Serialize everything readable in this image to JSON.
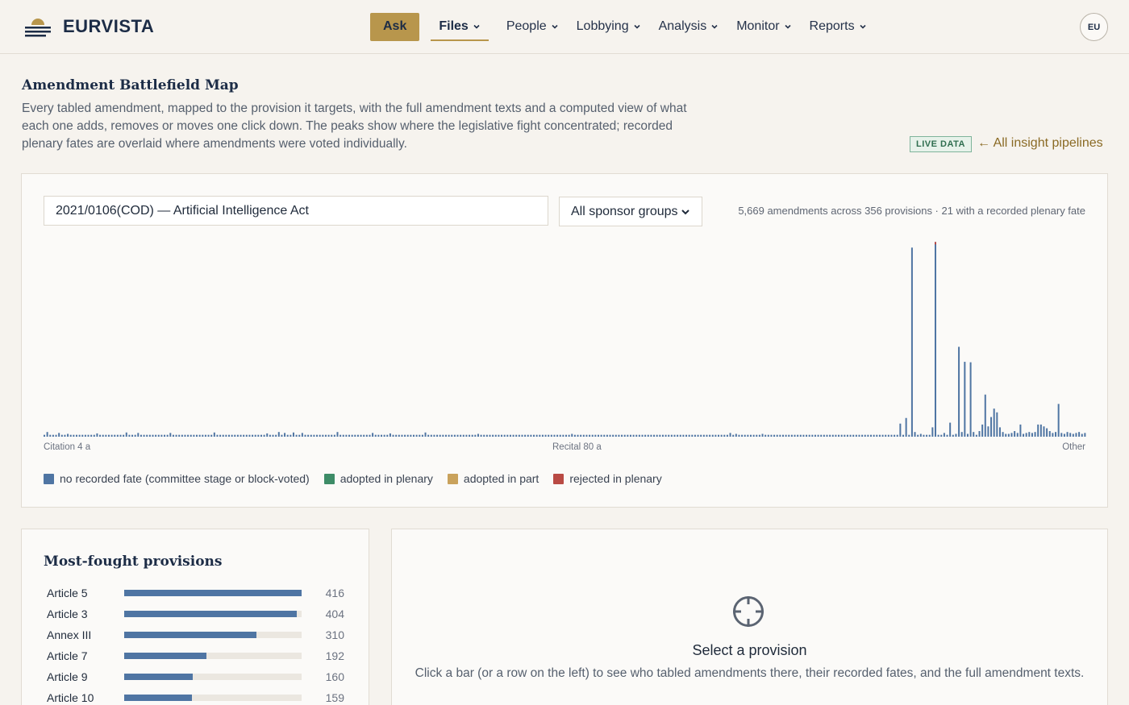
{
  "header": {
    "brand": "EURVISTA",
    "ask_label": "Ask",
    "nav": [
      "Files",
      "People",
      "Lobbying",
      "Analysis",
      "Monitor",
      "Reports"
    ],
    "avatar": "EU"
  },
  "intro": {
    "title": "Amendment Battlefield Map",
    "description": "Every tabled amendment, mapped to the provision it targets, with the full amendment texts and a computed view of what each one adds, removes or moves one click down. The peaks show where the legislative fight concentrated; recorded plenary fates are overlaid where amendments were voted individually.",
    "badge": "LIVE DATA",
    "back_link": "← All insight pipelines"
  },
  "filters": {
    "file_value": "2021/0106(COD) — Artificial Intelligence Act",
    "group_value": "All sponsor groups",
    "summary": "5,669 amendments across 356 provisions · 21 with a recorded plenary fate"
  },
  "chart_data": {
    "type": "bar",
    "title": "",
    "xlabel": "",
    "ylabel": "",
    "x_tick_labels": [
      "Citation 4 a",
      "Recital 80 a",
      "Other"
    ],
    "ylim": [
      0,
      420
    ],
    "grid": false,
    "legend_placement": "bottom-left",
    "categories_count": 356,
    "default_value": 4,
    "peaks": [
      {
        "index": 1,
        "value": 10
      },
      {
        "index": 5,
        "value": 8
      },
      {
        "index": 8,
        "value": 6
      },
      {
        "index": 18,
        "value": 7
      },
      {
        "index": 28,
        "value": 9
      },
      {
        "index": 32,
        "value": 8
      },
      {
        "index": 43,
        "value": 8
      },
      {
        "index": 58,
        "value": 9
      },
      {
        "index": 76,
        "value": 7
      },
      {
        "index": 80,
        "value": 10
      },
      {
        "index": 82,
        "value": 8
      },
      {
        "index": 85,
        "value": 9
      },
      {
        "index": 88,
        "value": 8
      },
      {
        "index": 100,
        "value": 10
      },
      {
        "index": 112,
        "value": 8
      },
      {
        "index": 118,
        "value": 7
      },
      {
        "index": 130,
        "value": 9
      },
      {
        "index": 148,
        "value": 6
      },
      {
        "index": 180,
        "value": 6
      },
      {
        "index": 234,
        "value": 8
      },
      {
        "index": 236,
        "value": 6
      },
      {
        "index": 245,
        "value": 6
      },
      {
        "index": 292,
        "value": 28
      },
      {
        "index": 294,
        "value": 40
      },
      {
        "index": 296,
        "value": 404
      },
      {
        "index": 297,
        "value": 10
      },
      {
        "index": 299,
        "value": 6
      },
      {
        "index": 301,
        "value": 4
      },
      {
        "index": 303,
        "value": 20
      },
      {
        "index": 304,
        "value": 416,
        "fate": "rejected"
      },
      {
        "index": 307,
        "value": 8
      },
      {
        "index": 309,
        "value": 30
      },
      {
        "index": 311,
        "value": 6
      },
      {
        "index": 312,
        "value": 192
      },
      {
        "index": 313,
        "value": 10
      },
      {
        "index": 314,
        "value": 160
      },
      {
        "index": 315,
        "value": 6
      },
      {
        "index": 316,
        "value": 159
      },
      {
        "index": 317,
        "value": 10
      },
      {
        "index": 319,
        "value": 12
      },
      {
        "index": 320,
        "value": 26
      },
      {
        "index": 321,
        "value": 90
      },
      {
        "index": 322,
        "value": 22
      },
      {
        "index": 323,
        "value": 42
      },
      {
        "index": 324,
        "value": 60
      },
      {
        "index": 325,
        "value": 52
      },
      {
        "index": 326,
        "value": 20
      },
      {
        "index": 327,
        "value": 10
      },
      {
        "index": 328,
        "value": 6
      },
      {
        "index": 329,
        "value": 6
      },
      {
        "index": 330,
        "value": 8
      },
      {
        "index": 331,
        "value": 12
      },
      {
        "index": 332,
        "value": 8
      },
      {
        "index": 333,
        "value": 26
      },
      {
        "index": 334,
        "value": 6
      },
      {
        "index": 335,
        "value": 8
      },
      {
        "index": 336,
        "value": 10
      },
      {
        "index": 337,
        "value": 8
      },
      {
        "index": 338,
        "value": 10
      },
      {
        "index": 339,
        "value": 26
      },
      {
        "index": 340,
        "value": 26
      },
      {
        "index": 341,
        "value": 22
      },
      {
        "index": 342,
        "value": 18
      },
      {
        "index": 343,
        "value": 12
      },
      {
        "index": 344,
        "value": 8
      },
      {
        "index": 345,
        "value": 10
      },
      {
        "index": 346,
        "value": 70
      },
      {
        "index": 347,
        "value": 8
      },
      {
        "index": 348,
        "value": 6
      },
      {
        "index": 349,
        "value": 10
      },
      {
        "index": 350,
        "value": 8
      },
      {
        "index": 351,
        "value": 6
      },
      {
        "index": 352,
        "value": 8
      },
      {
        "index": 353,
        "value": 10
      },
      {
        "index": 354,
        "value": 6
      },
      {
        "index": 355,
        "value": 8
      }
    ],
    "tail_peaks_note": "",
    "series": [
      {
        "name": "no recorded fate (committee stage or block-voted)",
        "color": "#4f75a3"
      },
      {
        "name": "adopted in plenary",
        "color": "#3d8c67"
      },
      {
        "name": "adopted in part",
        "color": "#c9a25c"
      },
      {
        "name": "rejected in plenary",
        "color": "#b94a44"
      }
    ]
  },
  "legend": {
    "items": [
      {
        "label": "no recorded fate (committee stage or block-voted)",
        "color": "#4f75a3"
      },
      {
        "label": "adopted in plenary",
        "color": "#3d8c67"
      },
      {
        "label": "adopted in part",
        "color": "#c9a25c"
      },
      {
        "label": "rejected in plenary",
        "color": "#b94a44"
      }
    ]
  },
  "most_fought": {
    "title": "Most-fought provisions",
    "max": 416,
    "rows": [
      {
        "name": "Article 5",
        "count": 416
      },
      {
        "name": "Article 3",
        "count": 404
      },
      {
        "name": "Annex III",
        "count": 310
      },
      {
        "name": "Article 7",
        "count": 192
      },
      {
        "name": "Article 9",
        "count": 160
      },
      {
        "name": "Article 10",
        "count": 159
      }
    ]
  },
  "detail": {
    "icon": "crosshair-icon",
    "title": "Select a provision",
    "description": "Click a bar (or a row on the left) to see who tabled amendments there, their recorded fates, and the full amendment texts."
  },
  "colors": {
    "accent": "#b8964c",
    "bar": "#4f75a3",
    "rejected": "#b94a44"
  }
}
